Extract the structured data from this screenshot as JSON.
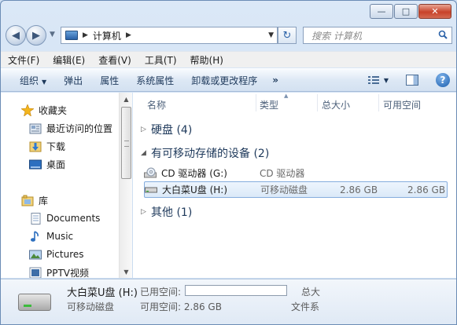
{
  "address": {
    "crumb": "计算机"
  },
  "search": {
    "placeholder": "搜索 计算机"
  },
  "menu": [
    "文件(F)",
    "编辑(E)",
    "查看(V)",
    "工具(T)",
    "帮助(H)"
  ],
  "toolbar": {
    "organize": "组织",
    "eject": "弹出",
    "properties": "属性",
    "system_properties": "系统属性",
    "uninstall": "卸载或更改程序",
    "more": "»"
  },
  "nav": {
    "favorites": {
      "label": "收藏夹",
      "items": [
        "最近访问的位置",
        "下载",
        "桌面"
      ]
    },
    "libraries": {
      "label": "库",
      "items": [
        "Documents",
        "Music",
        "Pictures",
        "PPTV视频"
      ]
    }
  },
  "columns": {
    "name": "名称",
    "type": "类型",
    "total": "总大小",
    "free": "可用空间"
  },
  "groups": {
    "hdd": "硬盘 (4)",
    "removable": "有可移动存储的设备 (2)",
    "other": "其他 (1)"
  },
  "devices": [
    {
      "name": "CD 驱动器 (G:)",
      "type": "CD 驱动器",
      "total": "",
      "free": ""
    },
    {
      "name": "大白菜U盘 (H:)",
      "type": "可移动磁盘",
      "total": "2.86 GB",
      "free": "2.86 GB"
    }
  ],
  "details": {
    "name": "大白菜U盘 (H:)",
    "type": "可移动磁盘",
    "used_label": "已用空间:",
    "free_label": "可用空间:",
    "free_value": "2.86 GB",
    "total_label": "总大",
    "fs_label": "文件系",
    "used_fraction": 0.0
  }
}
